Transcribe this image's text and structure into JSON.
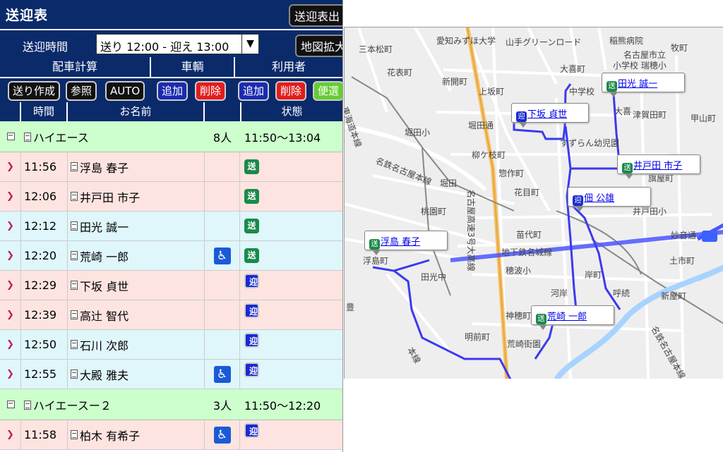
{
  "title": "送迎表",
  "title_button": "送迎表出",
  "time_label": "送迎時間",
  "time_select": "送り 12:00 - 迎え 13:00",
  "map_expand_button": "地図拡大",
  "sections": {
    "dispatch": "配車計算",
    "vehicle": "車輌",
    "user": "利用者"
  },
  "buttons": {
    "create": "送り作成",
    "view": "参照",
    "auto": "AUTO",
    "vehicle_add": "追加",
    "vehicle_delete": "削除",
    "user_add": "追加",
    "user_delete": "削除",
    "misc": "便選"
  },
  "columns": {
    "time": "時間",
    "name": "お名前",
    "status": "状態"
  },
  "groups": [
    {
      "name": "ハイエース",
      "count": "8人",
      "range": "11:50～13:04"
    },
    {
      "name": "ハイエースー２",
      "count": "3人",
      "range": "11:50～12:20"
    }
  ],
  "rows": [
    {
      "time": "11:56",
      "name": "浮島 春子",
      "wheelchair": false,
      "status": "送"
    },
    {
      "time": "12:06",
      "name": "井戸田 市子",
      "wheelchair": false,
      "status": "送"
    },
    {
      "time": "12:12",
      "name": "田光 誠一",
      "wheelchair": false,
      "status": "送"
    },
    {
      "time": "12:20",
      "name": "荒崎 一郎",
      "wheelchair": true,
      "status": "送"
    },
    {
      "time": "12:29",
      "name": "下坂 貞世",
      "wheelchair": false,
      "status": "迎"
    },
    {
      "time": "12:39",
      "name": "高辻 智代",
      "wheelchair": false,
      "status": "迎"
    },
    {
      "time": "12:50",
      "name": "石川 次郎",
      "wheelchair": false,
      "status": "迎"
    },
    {
      "time": "12:55",
      "name": "大殿 雅夫",
      "wheelchair": true,
      "status": "迎"
    },
    {
      "time": "11:58",
      "name": "柏木 有希子",
      "wheelchair": true,
      "status": "迎"
    }
  ],
  "map": {
    "labels": [
      "三本松町",
      "愛知みずほ大学",
      "山手グリーンロード",
      "稲熊病院",
      "名古屋市立",
      "小学校 瑞穂小",
      "牧町",
      "大喜町",
      "花表町",
      "新開町",
      "上坂町",
      "中学校",
      "津賀田町",
      "甲山町",
      "東海道本線",
      "堀田小",
      "堀田通",
      "すずらん幼児園",
      "柳ケ枝町",
      "名鉄名古屋本線",
      "堀田",
      "惣作町",
      "花目町",
      "名古屋高速3号大高線",
      "桃園町",
      "井戸田小",
      "苗代町",
      "妙音通",
      "浮島町",
      "地下鉄名城線",
      "田光中",
      "穂波小",
      "土市町",
      "岸町",
      "河岸",
      "呼続",
      "豊",
      "神穂町",
      "荒崎街園",
      "明前町",
      "新屋町",
      "名鉄名古屋本線",
      "大喜",
      "旗屋町",
      "本線"
    ],
    "markers": [
      {
        "kind": "送",
        "name": "田光 誠一"
      },
      {
        "kind": "迎",
        "name": "下坂 貞世"
      },
      {
        "kind": "送",
        "name": "井戸田 市子"
      },
      {
        "kind": "迎",
        "name": "佃 公雄"
      },
      {
        "kind": "送",
        "name": "浮島 春子"
      },
      {
        "kind": "送",
        "name": "荒崎 一郎"
      }
    ]
  }
}
